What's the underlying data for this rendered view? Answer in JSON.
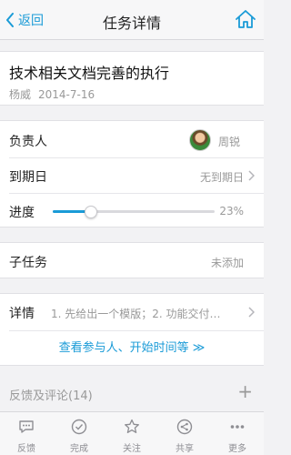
{
  "nav": {
    "back_label": "返回",
    "title": "任务详情"
  },
  "task": {
    "title": "技术相关文档完善的执行",
    "author": "杨威",
    "date": "2014-7-16"
  },
  "owner": {
    "label": "负责人",
    "name": "周锐"
  },
  "due": {
    "label": "到期日",
    "value": "无到期日"
  },
  "progress": {
    "label": "进度",
    "percent_text": "23%",
    "value": 0.23
  },
  "subtask": {
    "label": "子任务",
    "value": "未添加"
  },
  "detail": {
    "label": "详情",
    "text": "1. 先给出一个模版；2. 功能交付的…",
    "more_link": "查看参与人、开始时间等 ≫"
  },
  "comments": {
    "label": "反馈及评论(14)",
    "add": "+"
  },
  "tabbar": {
    "items": [
      {
        "label": "反馈",
        "icon": "chat-icon"
      },
      {
        "label": "完成",
        "icon": "check-icon"
      },
      {
        "label": "关注",
        "icon": "star-icon"
      },
      {
        "label": "共享",
        "icon": "share-icon"
      },
      {
        "label": "更多",
        "icon": "more-icon"
      }
    ]
  },
  "colors": {
    "accent": "#1a9bd7",
    "muted": "#999999",
    "background": "#f2f2f4"
  }
}
